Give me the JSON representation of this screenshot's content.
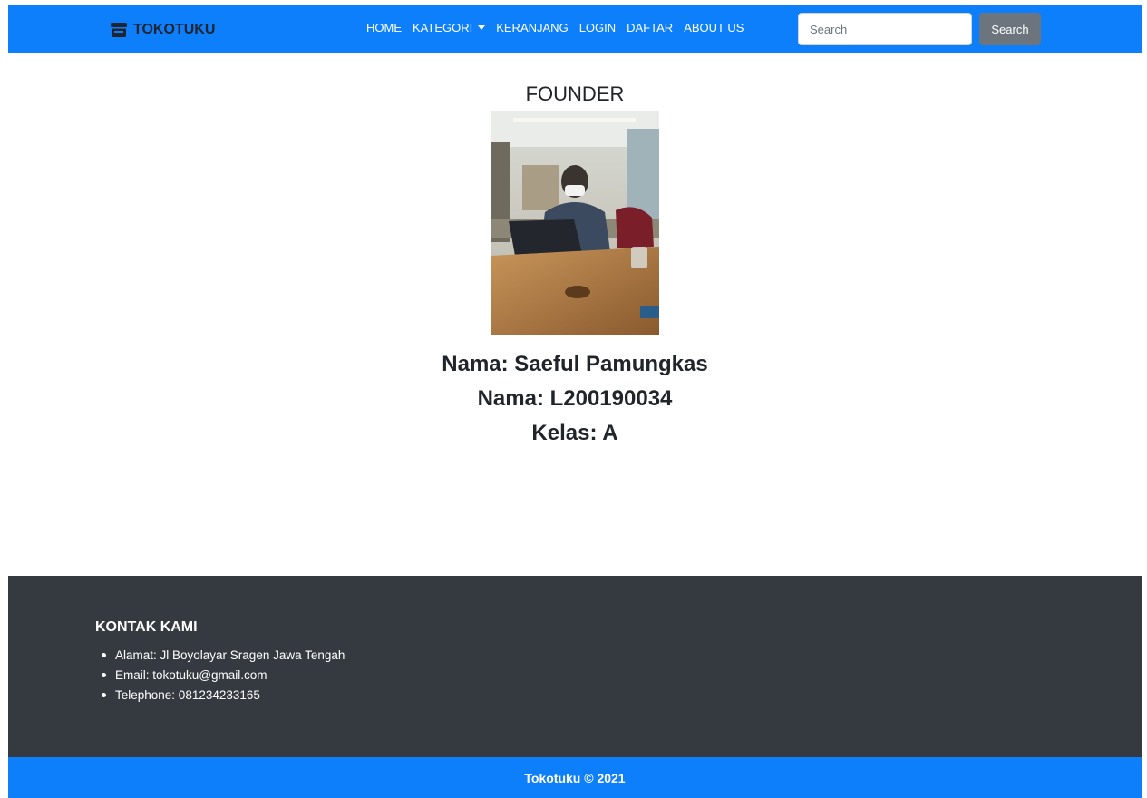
{
  "navbar": {
    "brand": "TOKOTUKU",
    "brand_icon": "store-icon",
    "items": [
      {
        "label": "HOME"
      },
      {
        "label": "KATEGORI"
      },
      {
        "label": "KERANJANG"
      },
      {
        "label": "LOGIN"
      },
      {
        "label": "DAFTAR"
      },
      {
        "label": "ABOUT US"
      }
    ],
    "search": {
      "placeholder": "Search",
      "button": "Search"
    },
    "color": "#0d7ffb"
  },
  "main": {
    "title": "FOUNDER",
    "info": [
      "Nama: Saeful Pamungkas",
      "Nama: L200190034",
      "Kelas: A"
    ]
  },
  "footer": {
    "heading": "KONTAK KAMI",
    "items": [
      "Alamat: Jl Boyolayar Sragen Jawa Tengah",
      "Email: tokotuku@gmail.com",
      "Telephone: 081234233165"
    ],
    "background": "#343a40",
    "copyright": "Tokotuku © 2021"
  }
}
